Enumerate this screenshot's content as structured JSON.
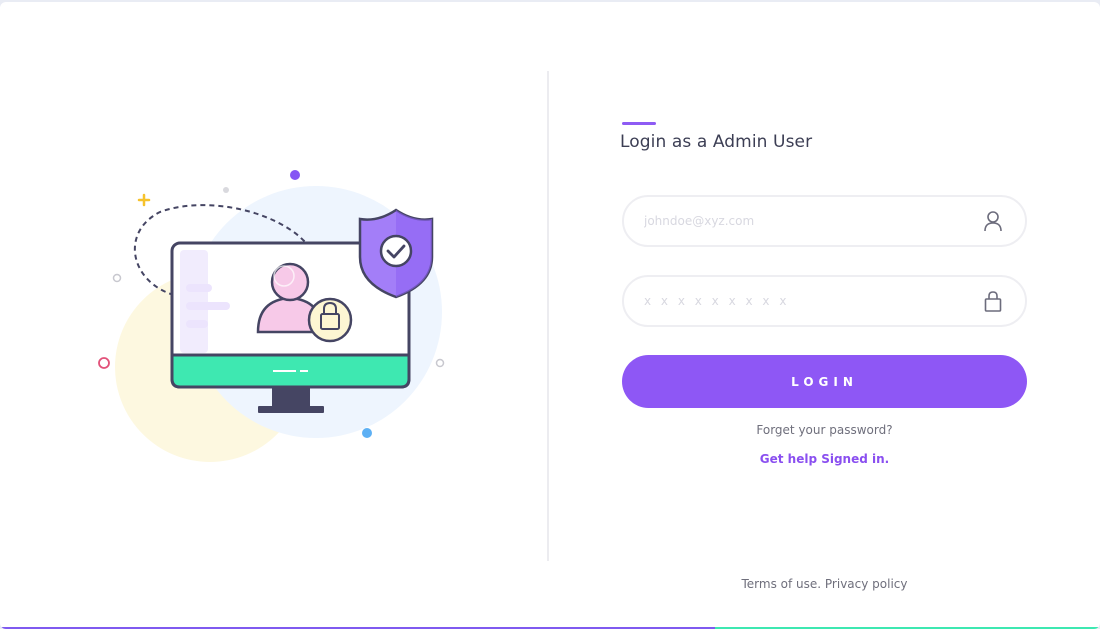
{
  "login": {
    "title": "Login as a Admin User",
    "email_placeholder": "johndoe@xyz.com",
    "password_placeholder": "x x x x x x x x x",
    "button_label": "LOGIN",
    "forgot_link": "Forget your password?",
    "help_link": "Get help Signed in."
  },
  "footer": {
    "terms": "Terms of use.",
    "privacy": "Privacy policy"
  },
  "icons": {
    "email_field_icon": "user-icon",
    "password_field_icon": "lock-icon"
  },
  "colors": {
    "accent": "#8e57f5",
    "illustration_screen_bar": "#3ee8b1",
    "link": "#8a4ff0"
  }
}
